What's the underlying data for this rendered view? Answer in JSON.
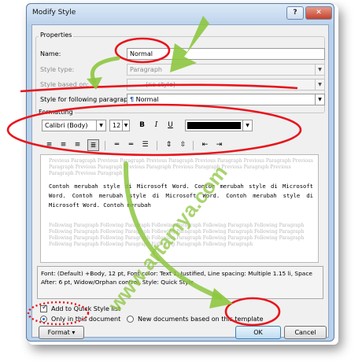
{
  "window": {
    "title": "Modify Style",
    "help_label": "?",
    "close_label": "✕"
  },
  "properties": {
    "group_label": "Properties",
    "name_label": "Name:",
    "name_value": "Normal",
    "style_type_label": "Style type:",
    "style_type_value": "Paragraph",
    "style_based_on_label": "Style based on:",
    "style_based_on_value": "(no style)",
    "style_following_label": "Style for following paragraph:",
    "style_following_value": "Normal",
    "style_following_icon": "paragraph-style-icon"
  },
  "formatting": {
    "group_label": "Formatting",
    "font_name": "Calibri (Body)",
    "font_size": "12",
    "bold_label": "B",
    "italic_label": "I",
    "underline_label": "U",
    "font_color": "#000000",
    "align_buttons": [
      "align-left-icon",
      "align-center-icon",
      "align-right-icon",
      "justify-icon"
    ],
    "spacing_buttons": [
      "single-spacing-icon",
      "one-half-spacing-icon",
      "double-spacing-icon"
    ],
    "paragraph_buttons": [
      "increase-space-before-icon",
      "decrease-space-before-icon",
      "decrease-indent-icon",
      "increase-indent-icon"
    ]
  },
  "preview": {
    "previous_text": "Previous Paragraph Previous Paragraph Previous Paragraph Previous Paragraph Previous Paragraph Previous Paragraph Previous Paragraph Previous Paragraph Previous Paragraph Previous Paragraph Previous Paragraph Previous Paragraph",
    "body_text": "Contoh merubah style di Microsoft Word. Contoh merubah style di Microsoft Word. Contoh merubah style di Microsoft Word. Contoh merubah style di Microsoft Word. Contoh merubah",
    "following_text": "Following Paragraph Following Paragraph Following Paragraph Following Paragraph Following Paragraph Following Paragraph Following Paragraph Following Paragraph Following Paragraph Following Paragraph Following Paragraph Following Paragraph Following Paragraph Following Paragraph Following Paragraph Following Paragraph Following Paragraph Following Paragraph Following Paragraph"
  },
  "description": "Font: (Default) +Body, 12 pt, Font color: Text 1, Justified, Line spacing: Multiple 1.15 li, Space After: 6 pt, Widow/Orphan control, Style: Quick Style",
  "options": {
    "add_quick_style_label": "Add to Quick Style list",
    "only_this_document_label": "Only in this document",
    "new_documents_label": "New documents based on this template"
  },
  "buttons": {
    "format_label": "Format ▾",
    "ok_label": "OK",
    "cancel_label": "Cancel"
  },
  "watermark": "www.artamya.com",
  "colors": {
    "annotation_red": "#e8141c",
    "arrow_green": "#8dc63f",
    "title_bar": "#bcd3ec"
  }
}
